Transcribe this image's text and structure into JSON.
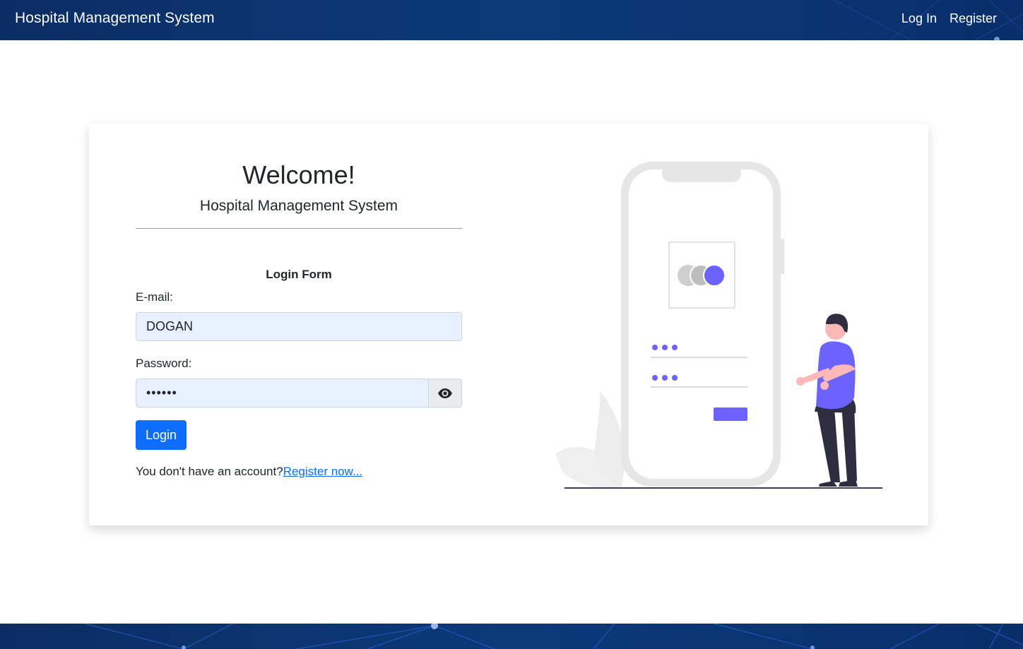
{
  "navbar": {
    "brand": "Hospital Management System",
    "links": [
      "Log In",
      "Register"
    ]
  },
  "card": {
    "welcome": "Welcome!",
    "subtitle": "Hospital Management System",
    "form_title": "Login Form",
    "email_label": "E-mail:",
    "email_value": "DOGAN",
    "password_label": "Password:",
    "password_value": "••••••",
    "login_button": "Login",
    "register_prompt": "You don't have an account?",
    "register_link": "Register now..."
  },
  "colors": {
    "navbar_bg": "#0b3a7a",
    "primary": "#0d6efd",
    "input_bg": "#e8f0fe",
    "illustration_accent": "#6c63ff"
  },
  "icons": {
    "password_toggle": "eye-icon"
  }
}
